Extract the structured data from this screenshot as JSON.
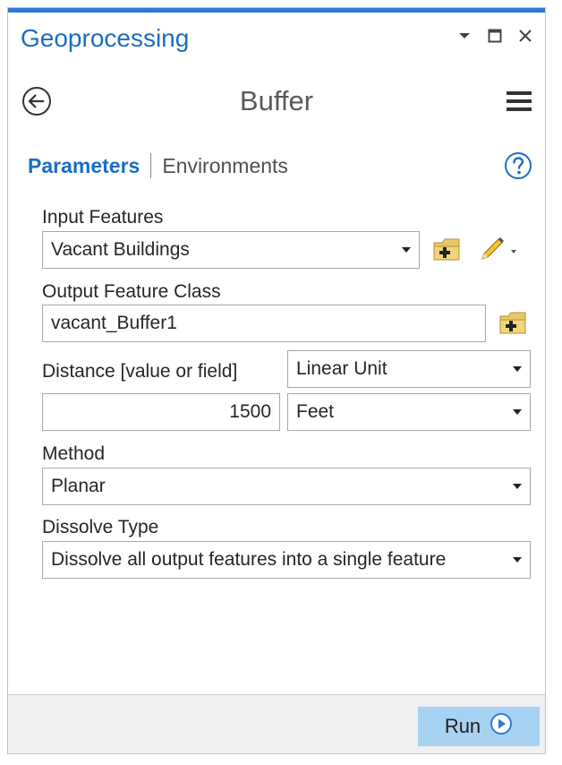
{
  "pane": {
    "title": "Geoprocessing"
  },
  "tool": {
    "title": "Buffer"
  },
  "tabs": {
    "parameters": "Parameters",
    "environments": "Environments"
  },
  "params": {
    "input_features": {
      "label": "Input Features",
      "value": "Vacant Buildings"
    },
    "output_feature_class": {
      "label": "Output Feature Class",
      "value": "vacant_Buffer1"
    },
    "distance": {
      "label": "Distance [value or field]",
      "type_value": "Linear Unit",
      "value": "1500",
      "unit": "Feet"
    },
    "method": {
      "label": "Method",
      "value": "Planar"
    },
    "dissolve_type": {
      "label": "Dissolve Type",
      "value": "Dissolve all output features into a single feature"
    }
  },
  "footer": {
    "run_label": "Run"
  },
  "icons": {
    "pane_menu": "chevron-down-icon",
    "maximize": "maximize-icon",
    "close": "close-icon",
    "back": "back-arrow-icon",
    "tool_menu": "hamburger-menu-icon",
    "help": "help-icon",
    "browse": "folder-add-icon",
    "edit": "pencil-icon",
    "run": "play-icon"
  },
  "colors": {
    "accent": "#1b6ec2",
    "run_button": "#a7d2f2",
    "top_bar": "#2b7bd6"
  }
}
